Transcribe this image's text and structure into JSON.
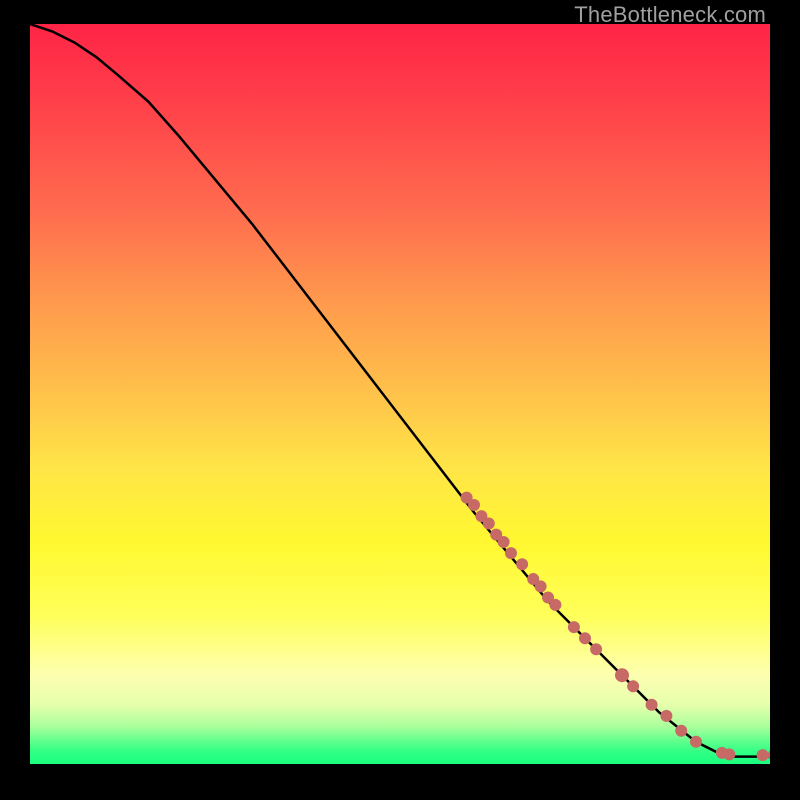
{
  "watermark": "TheBottleneck.com",
  "chart_data": {
    "type": "line",
    "title": "",
    "xlabel": "",
    "ylabel": "",
    "xlim": [
      0,
      100
    ],
    "ylim": [
      0,
      100
    ],
    "grid": false,
    "curve_points": [
      {
        "x": 0,
        "y": 100
      },
      {
        "x": 3,
        "y": 99
      },
      {
        "x": 6,
        "y": 97.5
      },
      {
        "x": 9,
        "y": 95.5
      },
      {
        "x": 12,
        "y": 93
      },
      {
        "x": 16,
        "y": 89.5
      },
      {
        "x": 20,
        "y": 85
      },
      {
        "x": 30,
        "y": 73
      },
      {
        "x": 40,
        "y": 60
      },
      {
        "x": 50,
        "y": 47
      },
      {
        "x": 60,
        "y": 34
      },
      {
        "x": 70,
        "y": 22
      },
      {
        "x": 80,
        "y": 12
      },
      {
        "x": 85,
        "y": 7
      },
      {
        "x": 90,
        "y": 3
      },
      {
        "x": 93,
        "y": 1.5
      },
      {
        "x": 95,
        "y": 1
      },
      {
        "x": 100,
        "y": 1
      }
    ],
    "data_points": [
      {
        "x": 59,
        "y": 36,
        "r": 6
      },
      {
        "x": 60,
        "y": 35,
        "r": 6
      },
      {
        "x": 61,
        "y": 33.5,
        "r": 6
      },
      {
        "x": 62,
        "y": 32.5,
        "r": 6
      },
      {
        "x": 63,
        "y": 31,
        "r": 6
      },
      {
        "x": 64,
        "y": 30,
        "r": 6
      },
      {
        "x": 65,
        "y": 28.5,
        "r": 6
      },
      {
        "x": 66.5,
        "y": 27,
        "r": 6
      },
      {
        "x": 68,
        "y": 25,
        "r": 6
      },
      {
        "x": 69,
        "y": 24,
        "r": 6
      },
      {
        "x": 70,
        "y": 22.5,
        "r": 6
      },
      {
        "x": 71,
        "y": 21.5,
        "r": 6
      },
      {
        "x": 73.5,
        "y": 18.5,
        "r": 6
      },
      {
        "x": 75,
        "y": 17,
        "r": 6
      },
      {
        "x": 76.5,
        "y": 15.5,
        "r": 6
      },
      {
        "x": 80,
        "y": 12,
        "r": 7
      },
      {
        "x": 81.5,
        "y": 10.5,
        "r": 6
      },
      {
        "x": 84,
        "y": 8,
        "r": 6
      },
      {
        "x": 86,
        "y": 6.5,
        "r": 6
      },
      {
        "x": 88,
        "y": 4.5,
        "r": 6
      },
      {
        "x": 90,
        "y": 3,
        "r": 6
      },
      {
        "x": 93.5,
        "y": 1.5,
        "r": 6
      },
      {
        "x": 94.5,
        "y": 1.3,
        "r": 6
      },
      {
        "x": 99,
        "y": 1.2,
        "r": 6
      },
      {
        "x": 100.5,
        "y": 1.2,
        "r": 6
      }
    ]
  },
  "colors": {
    "dot_fill": "#c76a66",
    "curve_stroke": "#000000"
  }
}
